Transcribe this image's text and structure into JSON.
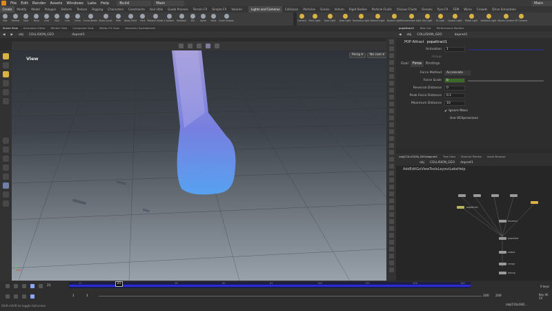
{
  "menu": [
    "File",
    "Edit",
    "Render",
    "Assets",
    "Windows",
    "Labs",
    "Help"
  ],
  "desktop": "Build",
  "desktop2": "Main",
  "desktop3": "Main",
  "shelf_tabs": [
    "Create",
    "Modify",
    "Model",
    "Polygon",
    "Deform",
    "Texture",
    "Rigging",
    "Characters",
    "Constraints",
    "Hair Utils",
    "Guide Process",
    "Terrain FX",
    "Simple FX",
    "Volume",
    "Lights and Cameras",
    "Collisions",
    "Particles",
    "Grains",
    "Vellum",
    "Rigid Bodies",
    "Particle Fluids",
    "Viscous Fluids",
    "Oceans",
    "Pyro FX",
    "FEM",
    "Wires",
    "Crowds",
    "Drive Simulation"
  ],
  "tools_left": [
    "Box",
    "Sphere",
    "Tube",
    "Torus",
    "Grid",
    "Null",
    "Line",
    "Circle",
    "Curve Bezier",
    "Draw Curve",
    "Path",
    "Spray Paint",
    "Font",
    "Platonic Solids",
    "L-System",
    "Metaball",
    "File",
    "Spiral",
    "Helix",
    "Quick Shapes"
  ],
  "tools_right": [
    "Camera",
    "Point Light",
    "Spot Light",
    "Area Light",
    "Geometry Light",
    "Volume Light",
    "Distant Light",
    "Environment Light",
    "Sky Light",
    "GI Light",
    "Caustic Light",
    "Portal Light",
    "Ambient Light",
    "Stereo Camera",
    "VR Camera"
  ],
  "panel_tabs_left": [
    "Scene View",
    "Animation Editor",
    "Render View",
    "Composite View",
    "Motion FX View",
    "Geometry Spreadsheet"
  ],
  "panel_tabs_right": [
    "popattract1",
    "Take List",
    "Performance Monitor"
  ],
  "path_left": [
    "obj",
    "COLLISION_GEO"
  ],
  "path_left_node": "dopnet1",
  "path_right": [
    "obj",
    "COLLISION_GEO"
  ],
  "path_right_node": "dopnet1",
  "viewport": {
    "label": "View",
    "persp": "Persp",
    "cam": "No cam"
  },
  "params": {
    "header": "POP Attract",
    "node": "popattract1",
    "activation_label": "Activation",
    "activation": "1",
    "group_label": "Group",
    "tabs": [
      "Goal",
      "Force",
      "Bindings"
    ],
    "active_tab": "Force",
    "force_method_label": "Force Method",
    "force_method": "Accelerate",
    "force_scale_label": "Force Scale",
    "force_scale": "8",
    "reversal_label": "Reversal Distance",
    "reversal": "0",
    "peak_label": "Peak Force Distance",
    "peak": "0.1",
    "max_label": "Maximum Distance",
    "max": "10",
    "ignore_mass": "Ignore Mass",
    "use_vex": "Use VEXpressions"
  },
  "net_tabs": [
    "/obj/COLLISION_GEO/dopnet1",
    "Tree View",
    "Material Palette",
    "Asset Browser"
  ],
  "net_menu": [
    "Add",
    "Edit",
    "Go",
    "View",
    "Tools",
    "Layout",
    "Labs",
    "Help"
  ],
  "net_nodes": [
    "popattract",
    "forcemix",
    "popsolver",
    "output",
    "merge",
    "wireup"
  ],
  "timeline": {
    "ticks": [
      "12",
      "36",
      "60",
      "84",
      "108",
      "132",
      "156",
      "180"
    ],
    "current": "21",
    "frame_display": "21",
    "start": "1",
    "start2": "1",
    "end": "200",
    "end2": "200",
    "keys": "0 keys",
    "key_all": "Key All Ch",
    "path": "/obj/COLLISIO..."
  },
  "status": "Shift+Shift to toggle fullscreen"
}
